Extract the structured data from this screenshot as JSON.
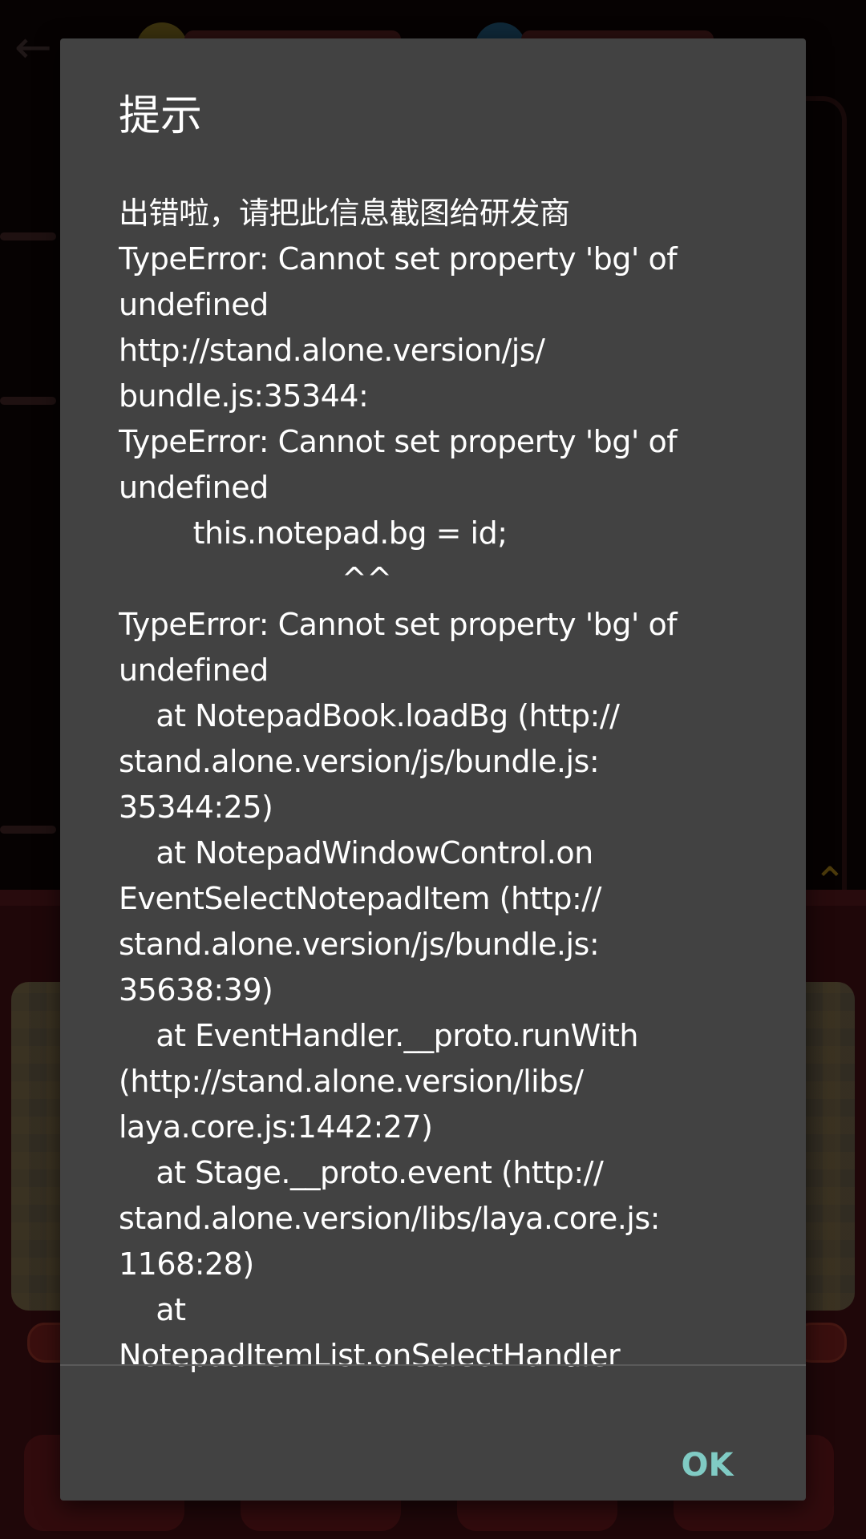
{
  "dialog": {
    "title": "提示",
    "message": "出错啦，请把此信息截图给研发商\nTypeError: Cannot set property 'bg' of\nundefined\nhttp://stand.alone.version/js/\nbundle.js:35344:\nTypeError: Cannot set property 'bg' of\nundefined\n        this.notepad.bg = id;\n                        ^^\nTypeError: Cannot set property 'bg' of\nundefined\n    at NotepadBook.loadBg (http://\nstand.alone.version/js/bundle.js:\n35344:25)\n    at NotepadWindowControl.on\nEventSelectNotepadItem (http://\nstand.alone.version/js/bundle.js:\n35638:39)\n    at EventHandler.__proto.runWith\n(http://stand.alone.version/libs/\nlaya.core.js:1442:27)\n    at Stage.__proto.event (http://\nstand.alone.version/libs/laya.core.js:\n1168:28)\n    at\nNotepadItemList.onSelectHandler",
    "ok_label": "OK"
  },
  "colors": {
    "dialog_background": "#424242",
    "text": "#ffffff",
    "accent": "#80cbc4"
  },
  "icons": {
    "back": "arrow-left-icon",
    "collapse": "chevron-up-icon"
  }
}
